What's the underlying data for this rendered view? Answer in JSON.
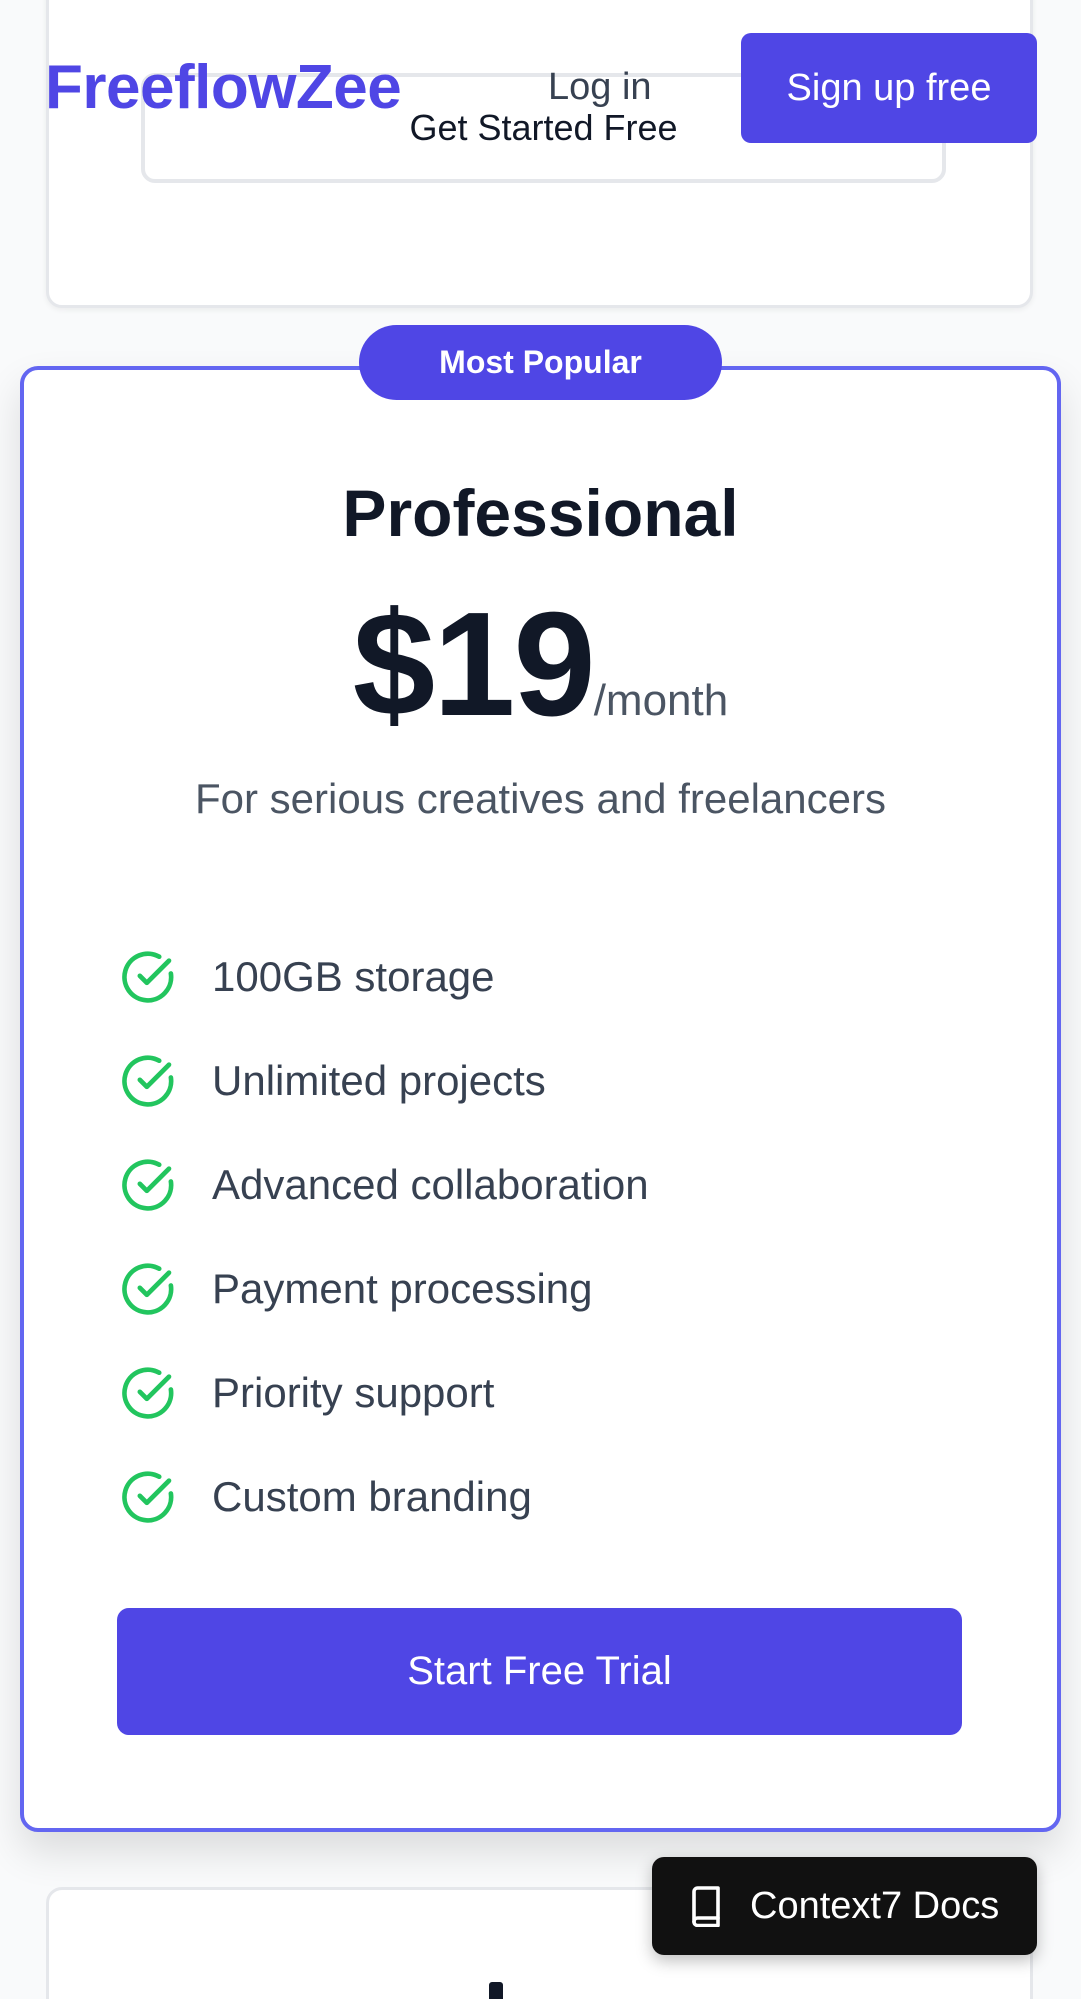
{
  "header": {
    "logo": "FreeflowZee",
    "login_label": "Log in",
    "signup_label": "Sign up free"
  },
  "top_card": {
    "button_label": "Get Started Free"
  },
  "pro_card": {
    "badge": "Most Popular",
    "name": "Professional",
    "price": "$19",
    "period": "/month",
    "tagline": "For serious creatives and freelancers",
    "features": [
      {
        "label": "100GB storage"
      },
      {
        "label": "Unlimited projects"
      },
      {
        "label": "Advanced collaboration"
      },
      {
        "label": "Payment processing"
      },
      {
        "label": "Priority support"
      },
      {
        "label": "Custom branding"
      }
    ],
    "cta_label": "Start Free Trial"
  },
  "docs_button": {
    "label": "Context7 Docs",
    "icon": "book-icon"
  },
  "colors": {
    "brand": "#4f46e5",
    "accent_border": "#6366f1",
    "check": "#22c55e",
    "dark": "#111111"
  }
}
